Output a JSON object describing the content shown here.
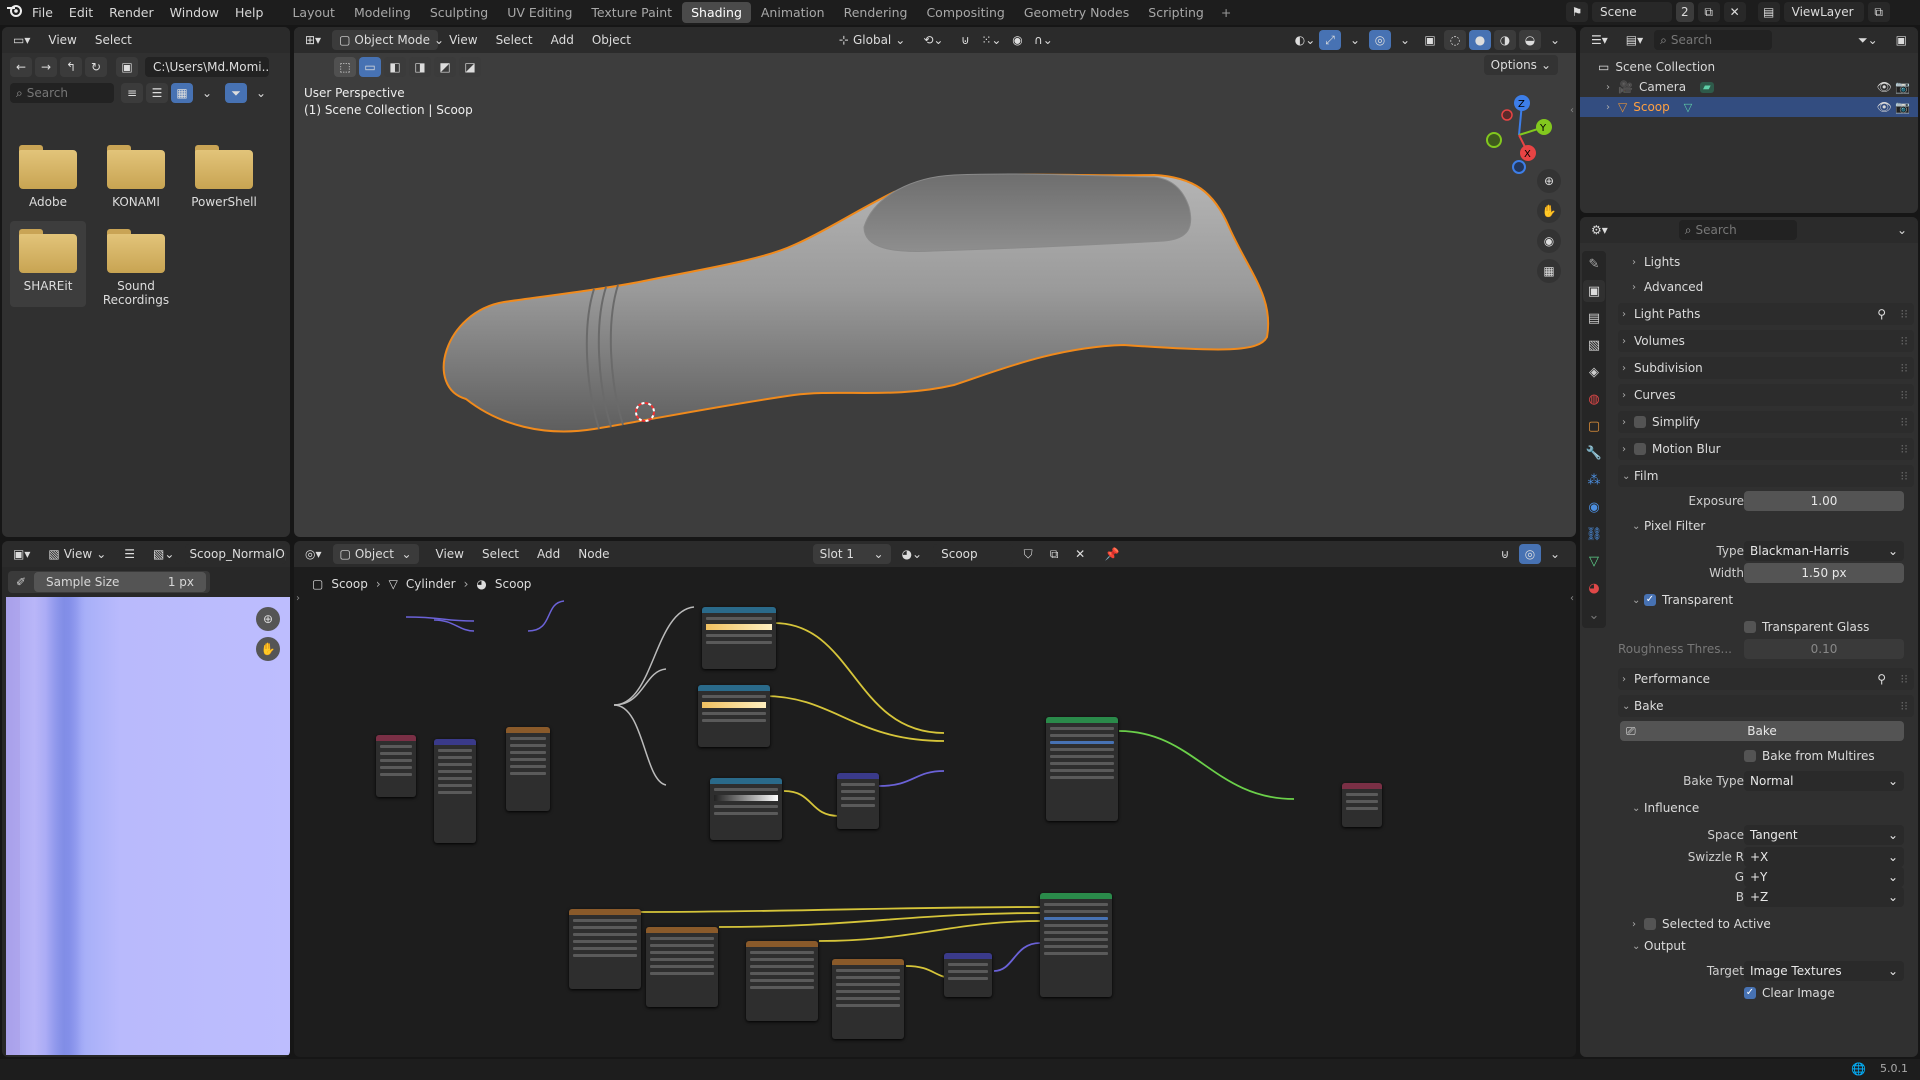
{
  "menu": {
    "file": "File",
    "edit": "Edit",
    "render": "Render",
    "window": "Window",
    "help": "Help"
  },
  "workspaces": [
    "Layout",
    "Modeling",
    "Sculpting",
    "UV Editing",
    "Texture Paint",
    "Shading",
    "Animation",
    "Rendering",
    "Compositing",
    "Geometry Nodes",
    "Scripting"
  ],
  "active_workspace": "Shading",
  "scene": {
    "name": "Scene",
    "users": "2",
    "view_layer": "ViewLayer"
  },
  "file_browser": {
    "view": "View",
    "select": "Select",
    "path": "C:\\Users\\Md.Momi...",
    "search_placeholder": "Search",
    "folders": [
      "Adobe",
      "KONAMI",
      "PowerShell",
      "SHAREit",
      "Sound Recordings"
    ]
  },
  "viewport": {
    "mode": "Object Mode",
    "view": "View",
    "select": "Select",
    "add": "Add",
    "object": "Object",
    "orientation": "Global",
    "options": "Options",
    "overlay_line1": "User Perspective",
    "overlay_line2": "(1) Scene Collection | Scoop"
  },
  "outliner": {
    "search_placeholder": "Search",
    "root": "Scene Collection",
    "items": [
      "Camera",
      "Scoop"
    ]
  },
  "properties": {
    "search_placeholder": "Search",
    "lights": "Lights",
    "advanced": "Advanced",
    "light_paths": "Light Paths",
    "volumes": "Volumes",
    "subdivision": "Subdivision",
    "curves": "Curves",
    "simplify": "Simplify",
    "motion_blur": "Motion Blur",
    "film": "Film",
    "exposure_label": "Exposure",
    "exposure": "1.00",
    "pixel_filter": "Pixel Filter",
    "type_label": "Type",
    "type": "Blackman-Harris",
    "width_label": "Width",
    "width": "1.50 px",
    "transparent": "Transparent",
    "transparent_glass": "Transparent Glass",
    "roughness_label": "Roughness Thres...",
    "roughness": "0.10",
    "performance": "Performance",
    "bake": "Bake",
    "bake_button": "Bake",
    "bake_from_multires": "Bake from Multires",
    "bake_type_label": "Bake Type",
    "bake_type": "Normal",
    "influence": "Influence",
    "space_label": "Space",
    "space": "Tangent",
    "swizzle_r_label": "Swizzle R",
    "swizzle_r": "+X",
    "swizzle_g_label": "G",
    "swizzle_g": "+Y",
    "swizzle_b_label": "B",
    "swizzle_b": "+Z",
    "selected_to_active": "Selected to Active",
    "output": "Output",
    "target_label": "Target",
    "target": "Image Textures",
    "clear_image": "Clear Image"
  },
  "image_editor": {
    "view": "View",
    "image_name": "Scoop_NormalOp",
    "sample_label": "Sample Size",
    "sample_value": "1 px"
  },
  "node_editor": {
    "object": "Object",
    "view": "View",
    "select": "Select",
    "add": "Add",
    "node": "Node",
    "slot": "Slot 1",
    "material": "Scoop",
    "breadcrumb": [
      "Scoop",
      "Cylinder",
      "Scoop"
    ]
  },
  "status": {
    "version": "5.0.1"
  }
}
